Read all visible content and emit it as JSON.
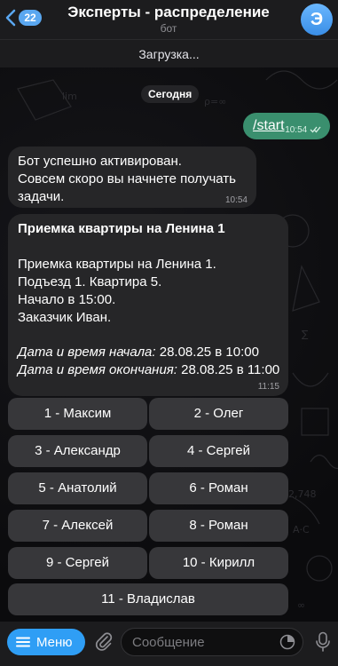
{
  "header": {
    "back_count": "22",
    "title": "Эксперты - распределение",
    "subtitle": "бот",
    "avatar_letter": "Э"
  },
  "status": {
    "loading": "Загрузка..."
  },
  "chat": {
    "date_chip": "Сегодня",
    "outgoing": {
      "text": "/start",
      "time": "10:54"
    },
    "msg1": {
      "lines": [
        "Бот успешно активирован.",
        "Совсем скоро вы начнете получать",
        "задачи."
      ],
      "time": "10:54"
    },
    "msg2": {
      "title": "Приемка квартиры на Ленина 1",
      "lines": [
        "Приемка квартиры на Ленина 1.",
        "Подъезд 1. Квартира 5.",
        "Начало в 15:00.",
        "Заказчик Иван."
      ],
      "start_label": "Дата и время начала:",
      "start_value": "28.08.25 в 10:00",
      "end_label": "Дата и время окончания:",
      "end_value": "28.08.25 в 11:00",
      "time": "11:15"
    },
    "keyboard": [
      "1 - Максим",
      "2 - Олег",
      "3 - Александр",
      "4 - Сергей",
      "5 - Анатолий",
      "6 - Роман",
      "7 - Алексей",
      "8 - Роман",
      "9 - Сергей",
      "10 - Кирилл",
      "11 - Владислав"
    ]
  },
  "composer": {
    "menu_label": "Меню",
    "placeholder": "Сообщение"
  },
  "colors": {
    "accent": "#2f9ef5",
    "outgoing_bubble": "#3a8f6e",
    "incoming_bubble": "#262628",
    "keyboard_button": "#37373a"
  },
  "icons": [
    "chevron-left-icon",
    "attach-clip-icon",
    "sticker-icon",
    "microphone-icon",
    "hamburger-icon",
    "double-check-icon"
  ]
}
